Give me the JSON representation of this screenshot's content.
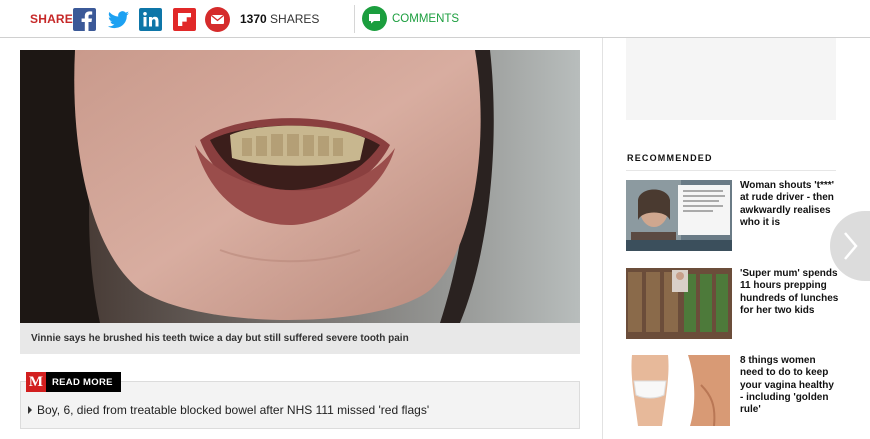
{
  "sharebar": {
    "share_label": "SHARE",
    "share_count": "1370",
    "shares_suffix": "SHARES",
    "comments_label": "COMMENTS",
    "icons": [
      "facebook-icon",
      "twitter-icon",
      "linkedin-icon",
      "flipboard-icon",
      "email-icon",
      "comment-icon"
    ]
  },
  "article": {
    "image_caption": "Vinnie says he brushed his teeth twice a day but still suffered severe tooth pain",
    "read_more": {
      "badge_letter": "M",
      "label": "READ MORE",
      "link_text": "Boy, 6, died from treatable blocked bowel after NHS 111 missed 'red flags'"
    }
  },
  "sidebar": {
    "recommended_title": "RECOMMENDED",
    "items": [
      {
        "headline": "Woman shouts 't***' at rude driver - then awkwardly realises who it is"
      },
      {
        "headline": "'Super mum' spends 11 hours prepping hundreds of lunches for her two kids"
      },
      {
        "headline": "8 things women need to do to keep your vagina healthy - including 'golden rule'"
      }
    ]
  },
  "colors": {
    "share_red": "#c62828",
    "facebook": "#3b5998",
    "twitter": "#1da1f2",
    "linkedin": "#0e76a8",
    "flipboard": "#e12828",
    "email": "#d52b2b",
    "comments_green": "#1b9e3e"
  }
}
